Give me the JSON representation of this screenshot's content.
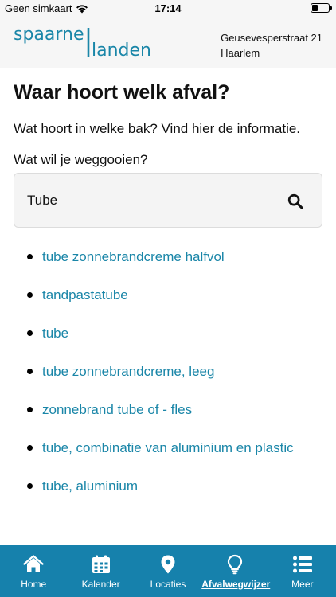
{
  "status_bar": {
    "carrier": "Geen simkaart",
    "time": "17:14"
  },
  "header": {
    "logo_line1": "spaarne",
    "logo_line2": "landen",
    "address_line1": "Geusevesperstraat 21",
    "address_line2": "Haarlem"
  },
  "main": {
    "title": "Waar hoort welk afval?",
    "intro": "Wat hoort in welke bak? Vind hier de informatie.",
    "question": "Wat wil je weggooien?",
    "search": {
      "value": "Tube"
    },
    "results": [
      "tube zonnebrandcreme halfvol",
      "tandpastatube",
      "tube",
      "tube zonnebrandcreme, leeg",
      "zonnebrand tube of - fles",
      "tube, combinatie van aluminium en plastic",
      "tube, aluminium"
    ]
  },
  "tabbar": {
    "items": [
      {
        "label": "Home",
        "icon": "home-icon"
      },
      {
        "label": "Kalender",
        "icon": "calendar-icon"
      },
      {
        "label": "Locaties",
        "icon": "location-pin-icon"
      },
      {
        "label": "Afvalwegwijzer",
        "icon": "lightbulb-icon",
        "active": true
      },
      {
        "label": "Meer",
        "icon": "list-icon"
      }
    ]
  },
  "colors": {
    "brand": "#1681ac",
    "link": "#1a86a8",
    "header_bg": "#f6f6f6"
  }
}
